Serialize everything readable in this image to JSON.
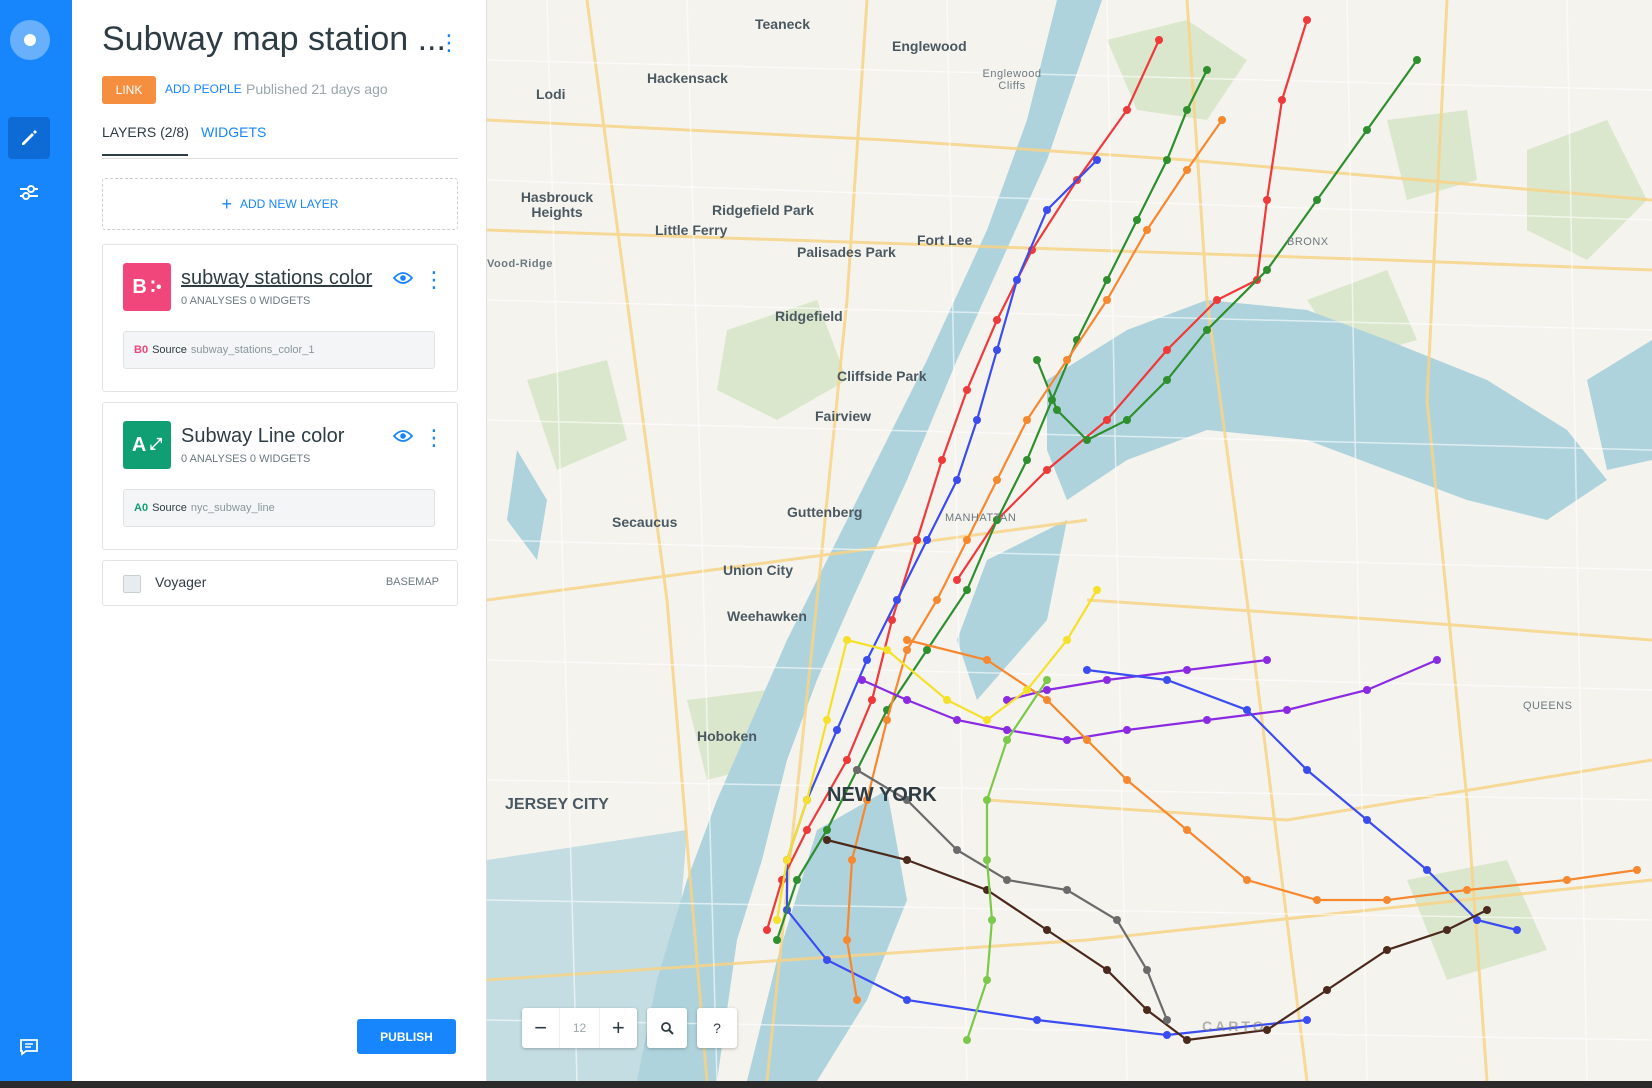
{
  "sidebar": {
    "title": "Subway map station ...",
    "share": {
      "link_label": "LINK",
      "add_people_label": "ADD PEOPLE",
      "published": "Published 21 days ago"
    },
    "tabs": [
      {
        "label": "LAYERS (2/8)",
        "active": true
      },
      {
        "label": "WIDGETS",
        "active": false
      }
    ],
    "add_layer_label": "ADD NEW LAYER",
    "layers": [
      {
        "badge_letter": "B",
        "badge_color": "#f0467b",
        "name": "subway stations color",
        "meta": "0 ANALYSES   0 WIDGETS",
        "source_node": "B0",
        "source_label": "Source",
        "source_table": "subway_stations_color_1"
      },
      {
        "badge_letter": "A",
        "badge_color": "#0f9f72",
        "name": "Subway Line color",
        "meta": "0 ANALYSES   0 WIDGETS",
        "source_node": "A0",
        "source_label": "Source",
        "source_table": "nyc_subway_line"
      }
    ],
    "basemap": {
      "name": "Voyager",
      "tag": "BASEMAP"
    },
    "publish_label": "PUBLISH"
  },
  "map": {
    "zoom_level": "12",
    "search_icon": "search-icon",
    "help_label": "?",
    "attribution": "CARTO",
    "labels": {
      "teaneck": "Teaneck",
      "englewood": "Englewood",
      "englewood_cliffs": "Englewood Cliffs",
      "lodi": "Lodi",
      "hackensack": "Hackensack",
      "hasbrouck": "Hasbrouck Heights",
      "ridgefield_park": "Ridgefield Park",
      "little_ferry": "Little Ferry",
      "palisades_park": "Palisades Park",
      "fort_lee": "Fort Lee",
      "wood_ridge": "Vood-Ridge",
      "ridgefield": "Ridgefield",
      "cliffside_park": "Cliffside Park",
      "fairview": "Fairview",
      "secaucus": "Secaucus",
      "guttenberg": "Guttenberg",
      "union_city": "Union City",
      "weehawken": "Weehawken",
      "hoboken": "Hoboken",
      "jersey_city": "JERSEY CITY",
      "new_york": "NEW YORK",
      "manhattan": "MANHATTAN",
      "bronx": "BRONX",
      "queens": "QUEENS"
    },
    "line_colors": {
      "red": "#ee3a3a",
      "blue": "#3b4cf0",
      "green": "#2f8f2f",
      "orange": "#f6882f",
      "yellow": "#f5e02a",
      "purple": "#8a2be2",
      "brown": "#4a2a1c",
      "gray": "#6b6b6b",
      "lightgreen": "#7cc84a"
    }
  }
}
